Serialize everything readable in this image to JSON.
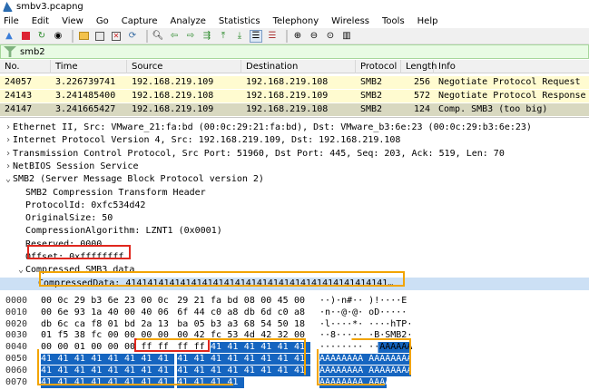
{
  "window": {
    "title": "smbv3.pcapng"
  },
  "menu": [
    "File",
    "Edit",
    "View",
    "Go",
    "Capture",
    "Analyze",
    "Statistics",
    "Telephony",
    "Wireless",
    "Tools",
    "Help"
  ],
  "toolbar": {
    "icons": [
      "shark-start-icon",
      "stop-icon",
      "restart-icon",
      "options-icon",
      "open-file-icon",
      "save-icon",
      "close-file-icon",
      "reload-icon",
      "find-icon",
      "back-icon",
      "forward-icon",
      "go-to-icon",
      "first-packet-icon",
      "last-packet-icon",
      "autoscroll-icon",
      "colorize-icon",
      "zoom-in-icon",
      "zoom-out-icon",
      "normal-size-icon",
      "resize-columns-icon"
    ]
  },
  "filter": {
    "value": "smb2"
  },
  "packet_list": {
    "columns": [
      "No.",
      "Time",
      "Source",
      "Destination",
      "Protocol",
      "Length",
      "Info"
    ],
    "rows": [
      {
        "no": "24057",
        "time": "3.226739741",
        "src": "192.168.219.109",
        "dst": "192.168.219.108",
        "proto": "SMB2",
        "len": "256",
        "info": "Negotiate Protocol Request"
      },
      {
        "no": "24143",
        "time": "3.241485400",
        "src": "192.168.219.108",
        "dst": "192.168.219.109",
        "proto": "SMB2",
        "len": "572",
        "info": "Negotiate Protocol Response"
      },
      {
        "no": "24147",
        "time": "3.241665427",
        "src": "192.168.219.109",
        "dst": "192.168.219.108",
        "proto": "SMB2",
        "len": "124",
        "info": "Comp. SMB3 (too big)"
      }
    ],
    "colors": {
      "row": "#fffbd0",
      "selected": "#d8d8c0"
    }
  },
  "details": [
    {
      "indent": 0,
      "arrow": ">",
      "text": "Ethernet II, Src: VMware_21:fa:bd (00:0c:29:21:fa:bd), Dst: VMware_b3:6e:23 (00:0c:29:b3:6e:23)"
    },
    {
      "indent": 0,
      "arrow": ">",
      "text": "Internet Protocol Version 4, Src: 192.168.219.109, Dst: 192.168.219.108"
    },
    {
      "indent": 0,
      "arrow": ">",
      "text": "Transmission Control Protocol, Src Port: 51960, Dst Port: 445, Seq: 203, Ack: 519, Len: 70"
    },
    {
      "indent": 0,
      "arrow": ">",
      "text": "NetBIOS Session Service"
    },
    {
      "indent": 0,
      "arrow": "v",
      "text": "SMB2 (Server Message Block Protocol version 2)"
    },
    {
      "indent": 1,
      "arrow": "",
      "text": "SMB2 Compression Transform Header"
    },
    {
      "indent": 1,
      "arrow": "",
      "text": "ProtocolId: 0xfc534d42"
    },
    {
      "indent": 1,
      "arrow": "",
      "text": "OriginalSize: 50"
    },
    {
      "indent": 1,
      "arrow": "",
      "text": "CompressionAlgorithm: LZNT1 (0x0001)"
    },
    {
      "indent": 1,
      "arrow": "",
      "text": "Reserved: 0000"
    },
    {
      "indent": 1,
      "arrow": "",
      "text": "Offset: 0xffffffff"
    },
    {
      "indent": 1,
      "arrow": "v",
      "text": "Compressed SMB3 data"
    },
    {
      "indent": 2,
      "arrow": "",
      "text": "CompressedData: 414141414141414141414141414141414141414141414141…"
    }
  ],
  "hex": [
    {
      "off": "0000",
      "bytes": [
        "00",
        "0c",
        "29",
        "b3",
        "6e",
        "23",
        "00",
        "0c",
        "29",
        "21",
        "fa",
        "bd",
        "08",
        "00",
        "45",
        "00"
      ],
      "ascii": "··)·n#··  )!····E",
      "hl_from": -1
    },
    {
      "off": "0010",
      "bytes": [
        "00",
        "6e",
        "93",
        "1a",
        "40",
        "00",
        "40",
        "06",
        "6f",
        "44",
        "c0",
        "a8",
        "db",
        "6d",
        "c0",
        "a8"
      ],
      "ascii": "·n··@·@·  oD·····",
      "hl_from": -1
    },
    {
      "off": "0020",
      "bytes": [
        "db",
        "6c",
        "ca",
        "f8",
        "01",
        "bd",
        "2a",
        "13",
        "ba",
        "05",
        "b3",
        "a3",
        "68",
        "54",
        "50",
        "18"
      ],
      "ascii": "·l····*·  ····hTP·",
      "hl_from": -1
    },
    {
      "off": "0030",
      "bytes": [
        "01",
        "f5",
        "38",
        "fc",
        "00",
        "00",
        "00",
        "00",
        "00",
        "42",
        "fc",
        "53",
        "4d",
        "42",
        "32",
        "00"
      ],
      "ascii": "··8·····  ·B·SMB2·",
      "hl_from": -1
    },
    {
      "off": "0040",
      "bytes": [
        "00",
        "00",
        "01",
        "00",
        "00",
        "00",
        "ff",
        "ff",
        "ff",
        "ff",
        "41",
        "41",
        "41",
        "41",
        "41",
        "41"
      ],
      "ascii": "········  ··AAAAAA",
      "hl_from": 10
    },
    {
      "off": "0050",
      "bytes": [
        "41",
        "41",
        "41",
        "41",
        "41",
        "41",
        "41",
        "41",
        "41",
        "41",
        "41",
        "41",
        "41",
        "41",
        "41",
        "41"
      ],
      "ascii": "AAAAAAAA  AAAAAAAA",
      "hl_from": 0
    },
    {
      "off": "0060",
      "bytes": [
        "41",
        "41",
        "41",
        "41",
        "41",
        "41",
        "41",
        "41",
        "41",
        "41",
        "41",
        "41",
        "41",
        "41",
        "41",
        "41"
      ],
      "ascii": "AAAAAAAA  AAAAAAAA",
      "hl_from": 0
    },
    {
      "off": "0070",
      "bytes": [
        "41",
        "41",
        "41",
        "41",
        "41",
        "41",
        "41",
        "41",
        "41",
        "41",
        "41",
        "41"
      ],
      "ascii": "AAAAAAAA  AAAA",
      "hl_from": 0
    }
  ]
}
